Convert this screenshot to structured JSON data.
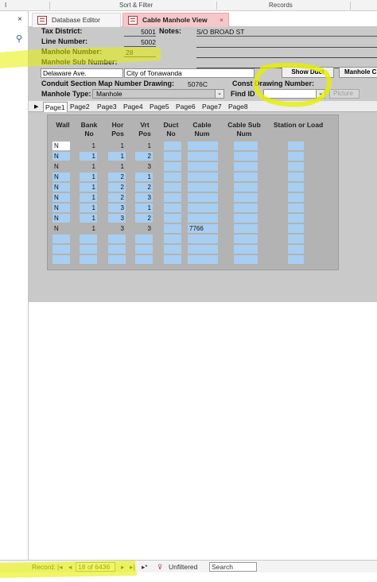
{
  "ribbon": {
    "left_label": "I",
    "group_sort": "Sort & Filter",
    "group_records": "Records"
  },
  "nav": {
    "close_glyph": "×",
    "search_glyph": "⚲"
  },
  "tabs": [
    {
      "label": "Database Editor"
    },
    {
      "label": "Cable Manhole View",
      "close": "×"
    }
  ],
  "form": {
    "tax_district_label": "Tax District:",
    "tax_district_value": "5001",
    "notes_label": "Notes:",
    "notes_value": "S/O  BROAD ST",
    "line_number_label": "Line Number:",
    "line_number_value": "5002",
    "manhole_number_label": "Manhole Number:",
    "manhole_number_value": "28",
    "manhole_sub_label": "Manhole Sub Number:",
    "street": "Delaware Ave.",
    "city": "City of Tonawanda",
    "show_duct_button": "Show Duct",
    "manhole_c_button": "Manhole C",
    "conduit_label": "Conduit Section Map Number Drawing:",
    "conduit_value": "5076C",
    "const_drawing_label": "Const Drawing Number:",
    "manhole_type_label": "Manhole Type:",
    "manhole_type_value": "Manhole",
    "find_id_label": "Find ID",
    "find_id_value": "",
    "picture_button": "Picture",
    "dropdown_glyph": "⌄"
  },
  "page_tabs": [
    "Page1",
    "Page2",
    "Page3",
    "Page4",
    "Page5",
    "Page6",
    "Page7",
    "Page8"
  ],
  "grid": {
    "headers": [
      {
        "line1": "Wall",
        "line2": ""
      },
      {
        "line1": "Bank",
        "line2": "No"
      },
      {
        "line1": "Hor",
        "line2": "Pos"
      },
      {
        "line1": "Vrt",
        "line2": "Pos"
      },
      {
        "line1": "Duct",
        "line2": "No"
      },
      {
        "line1": "Cable",
        "line2": "Num"
      },
      {
        "line1": "Cable Sub",
        "line2": "Num"
      },
      {
        "line1": "Station or Load",
        "line2": ""
      }
    ],
    "rows": [
      [
        "N",
        "1",
        "1",
        "1",
        "",
        "",
        "",
        ""
      ],
      [
        "N",
        "1",
        "1",
        "2",
        "",
        "",
        "",
        ""
      ],
      [
        "N",
        "1",
        "1",
        "3",
        "",
        "",
        "",
        ""
      ],
      [
        "N",
        "1",
        "2",
        "1",
        "",
        "",
        "",
        ""
      ],
      [
        "N",
        "1",
        "2",
        "2",
        "",
        "",
        "",
        ""
      ],
      [
        "N",
        "1",
        "2",
        "3",
        "",
        "",
        "",
        ""
      ],
      [
        "N",
        "1",
        "3",
        "1",
        "",
        "",
        "",
        ""
      ],
      [
        "N",
        "1",
        "3",
        "2",
        "",
        "",
        "",
        ""
      ],
      [
        "N",
        "1",
        "3",
        "3",
        "",
        "7766",
        "",
        ""
      ],
      [
        "",
        "",
        "",
        "",
        "",
        "",
        "",
        ""
      ],
      [
        "",
        "",
        "",
        "",
        "",
        "",
        "",
        ""
      ],
      [
        "",
        "",
        "",
        "",
        "",
        "",
        "",
        ""
      ]
    ]
  },
  "status": {
    "record_label": "Record:",
    "first_glyph": "|◂",
    "prev_glyph": "◂",
    "record_position": "18 of 6436",
    "next_glyph": "▸",
    "last_glyph": "▸|",
    "new_glyph": "▸*",
    "filter_label": "Unfiltered",
    "search_label": "Search"
  },
  "colors": {
    "form_bg": "#c9c9c9",
    "cell_blue": "#a8cef1",
    "highlighter": "#e6f000",
    "active_tab": "#f4c7c9"
  }
}
